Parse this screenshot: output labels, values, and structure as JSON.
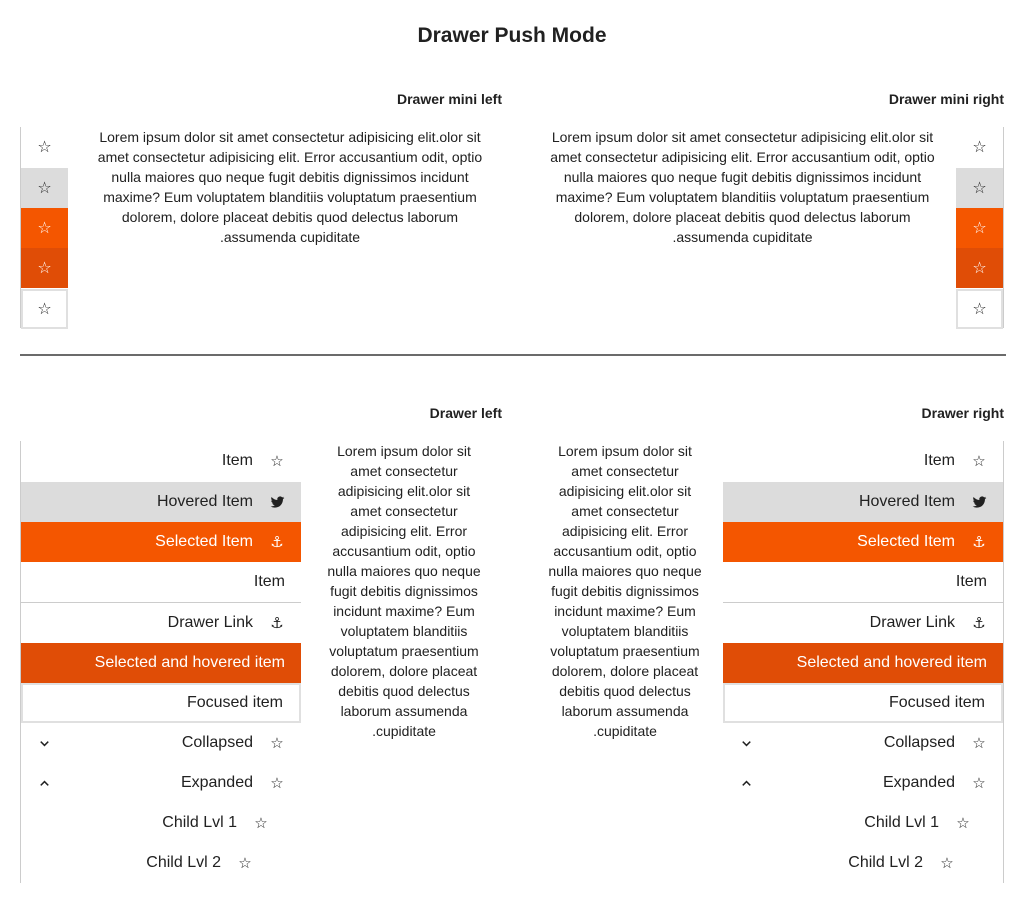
{
  "title": "Drawer Push Mode",
  "sections": {
    "mini_left": "Drawer mini left",
    "mini_right": "Drawer mini right",
    "drawer_left": "Drawer left",
    "drawer_right": "Drawer right"
  },
  "lorem": "Lorem ipsum dolor sit amet consectetur adipisicing elit.olor sit amet consectetur adipisicing elit. Error accusantium odit, optio nulla maiores quo neque fugit debitis dignissimos incidunt maxime? Eum voluptatem blanditiis voluptatum praesentium dolorem, dolore placeat debitis quod delectus laborum assumenda cupiditate.",
  "mini_items": [
    {
      "state": "normal",
      "icon": "star-icon"
    },
    {
      "state": "hovered",
      "icon": "star-icon"
    },
    {
      "state": "selected",
      "icon": "star-icon"
    },
    {
      "state": "selected-hovered",
      "icon": "star-icon"
    },
    {
      "state": "focused",
      "icon": "star-icon"
    }
  ],
  "drawer_items": [
    {
      "label": "Item",
      "icon": "star-icon"
    },
    {
      "label": "Hovered Item",
      "icon": "twitter-icon"
    },
    {
      "label": "Selected Item",
      "icon": "anchor-icon"
    },
    {
      "label": "Item",
      "icon": ""
    },
    {
      "label": "Drawer Link",
      "icon": "anchor-icon"
    },
    {
      "label": "Selected and hovered item",
      "icon": ""
    },
    {
      "label": "Focused item",
      "icon": ""
    },
    {
      "label": "Collapsed",
      "icon": "star-icon",
      "chevron": "chevron-down-icon"
    },
    {
      "label": "Expanded",
      "icon": "star-icon",
      "chevron": "chevron-up-icon"
    },
    {
      "label": "Child Lvl 1",
      "icon": "star-icon"
    },
    {
      "label": "Child Lvl 2",
      "icon": "star-icon"
    }
  ],
  "colors": {
    "selected": "#f45600",
    "selected_hovered": "#e04d06",
    "hovered": "#dcdcdc",
    "divider": "#6b6b6b"
  }
}
